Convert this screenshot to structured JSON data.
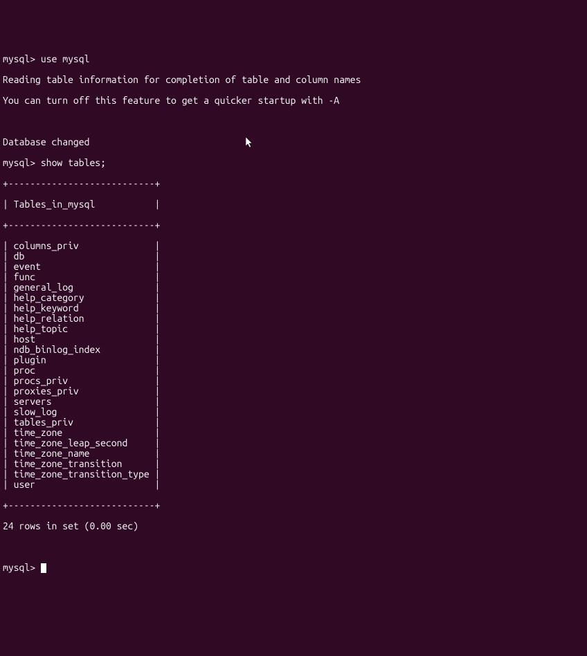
{
  "terminal": {
    "prompt": "mysql>",
    "command1": "use mysql",
    "msg_reading": "Reading table information for completion of table and column names",
    "msg_turnoff": "You can turn off this feature to get a quicker startup with -A",
    "msg_changed": "Database changed",
    "command2": "show tables;",
    "table_border": "+---------------------------+",
    "table_header": "Tables_in_mysql",
    "rows": [
      "columns_priv",
      "db",
      "event",
      "func",
      "general_log",
      "help_category",
      "help_keyword",
      "help_relation",
      "help_topic",
      "host",
      "ndb_binlog_index",
      "plugin",
      "proc",
      "procs_priv",
      "proxies_priv",
      "servers",
      "slow_log",
      "tables_priv",
      "time_zone",
      "time_zone_leap_second",
      "time_zone_name",
      "time_zone_transition",
      "time_zone_transition_type",
      "user"
    ],
    "result_line": "24 rows in set (0.00 sec)"
  }
}
